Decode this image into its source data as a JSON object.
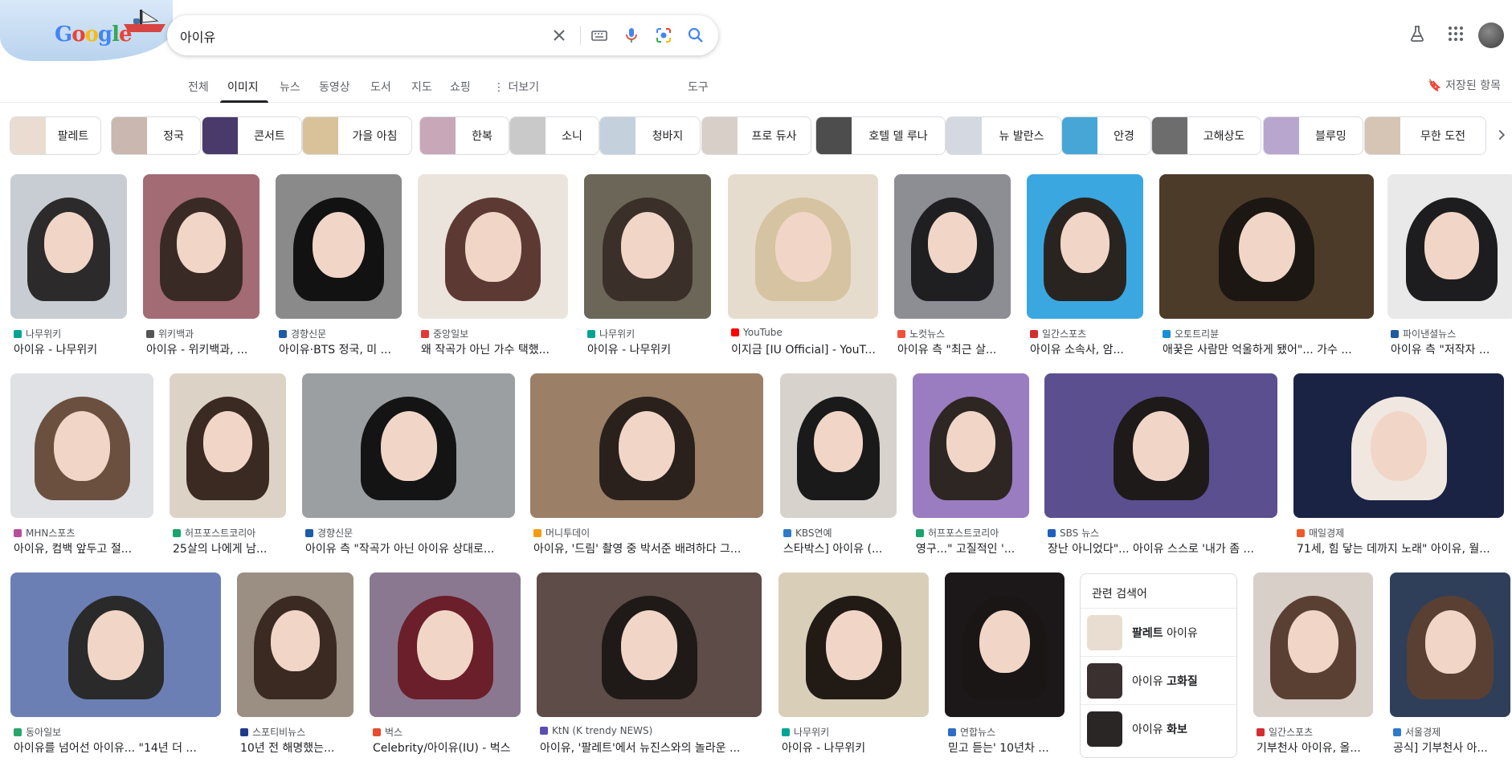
{
  "search": {
    "query": "아이유"
  },
  "tabs": [
    {
      "label": "전체"
    },
    {
      "label": "이미지"
    },
    {
      "label": "뉴스"
    },
    {
      "label": "동영상"
    },
    {
      "label": "도서"
    },
    {
      "label": "지도"
    },
    {
      "label": "쇼핑"
    },
    {
      "label": "더보기"
    },
    {
      "label": "도구"
    }
  ],
  "saved_label": "저장된 항목",
  "chips": [
    {
      "label": "팔레트",
      "color": "#e8ddd0"
    },
    {
      "label": "정국",
      "color": "#c9b7b0"
    },
    {
      "label": "콘서트",
      "color": "#4a3a6b"
    },
    {
      "label": "가을 아침",
      "color": "#d9c29a"
    },
    {
      "label": "한복",
      "color": "#c8a7b8"
    },
    {
      "label": "소니",
      "color": "#c9c9c9"
    },
    {
      "label": "청바지",
      "color": "#c4d0dc"
    },
    {
      "label": "프로 듀사",
      "color": "#d8d0c8"
    },
    {
      "label": "호텔 델 루나",
      "color": "#4d4d4d"
    },
    {
      "label": "뉴 발란스",
      "color": "#d4d8e0"
    },
    {
      "label": "안경",
      "color": "#47a6d6"
    },
    {
      "label": "고해상도",
      "color": "#6d6d6d"
    },
    {
      "label": "블루밍",
      "color": "#b8a6cf"
    },
    {
      "label": "무한 도전",
      "color": "#d6c4b4"
    }
  ],
  "row1": [
    {
      "source": "나무위키",
      "title": "아이유 - 나무위키",
      "fav": "#00a495",
      "bg": "#c7cdd3",
      "hair": "#2c2a2b"
    },
    {
      "source": "위키백과",
      "title": "아이유 - 위키백과, ...",
      "fav": "#555555",
      "bg": "#a36b74",
      "hair": "#3a2a26"
    },
    {
      "source": "경향신문",
      "title": "아이유·BTS 정국, 미 ...",
      "fav": "#1d5aa8",
      "bg": "#8a8a8a",
      "hair": "#121212"
    },
    {
      "source": "중앙일보",
      "title": "왜 작곡가 아닌 가수 택했...",
      "fav": "#e53935",
      "bg": "#ebe4dd",
      "hair": "#5c3a33"
    },
    {
      "source": "나무위키",
      "title": "아이유 - 나무위키",
      "fav": "#00a495",
      "bg": "#6c6659",
      "hair": "#3b2f29"
    },
    {
      "source": "YouTube",
      "title": "이지금 [IU Official] - YouT...",
      "fav": "#ff0000",
      "bg": "#e6dccd",
      "hair": "#d6c3a2"
    },
    {
      "source": "노컷뉴스",
      "title": "아이유 측 \"최근 살...",
      "fav": "#f0503c",
      "bg": "#8d8d94",
      "hair": "#1f1f22"
    },
    {
      "source": "일간스포츠",
      "title": "아이유 소속사, 암...",
      "fav": "#d32f2f",
      "bg": "#3ba7e0",
      "hair": "#2a2420"
    },
    {
      "source": "오토트리뷴",
      "title": "애꿎은 사람만 억울하게 됐어\"... 가수 ...",
      "fav": "#1a8fd6",
      "bg": "#4b3b28",
      "hair": "#1c1712"
    },
    {
      "source": "파이낸셜뉴스",
      "title": "아이유 측 \"저작자 ...",
      "fav": "#1e5aa0",
      "bg": "#e9e9ea",
      "hair": "#1d1d1f"
    }
  ],
  "row2": [
    {
      "source": "MHN스포츠",
      "title": "아이유, 컴백 앞두고 절...",
      "fav": "#b74f9d",
      "bg": "#dfe1e4",
      "hair": "#6b5040"
    },
    {
      "source": "허프포스트코리아",
      "title": "25살의 나에게 남...",
      "fav": "#1aa36b",
      "bg": "#dcd3c6",
      "hair": "#3a2a22"
    },
    {
      "source": "경향신문",
      "title": "아이유 측 \"작곡가 아닌 아이유 상대로...",
      "fav": "#1d5aa8",
      "bg": "#9c9fa2",
      "hair": "#141414"
    },
    {
      "source": "머니투데이",
      "title": "아이유, '드림' 촬영 중 박서준 배려하다 그...",
      "fav": "#f39c12",
      "bg": "#9b7f67",
      "hair": "#2a211c"
    },
    {
      "source": "KBS연예",
      "title": "스타박스] 아이유 (...",
      "fav": "#2c7ac9",
      "bg": "#d7d3cc",
      "hair": "#1b1a1a"
    },
    {
      "source": "허프포스트코리아",
      "title": "영구...\" 고질적인 '...",
      "fav": "#1aa36b",
      "bg": "#9a7cc0",
      "hair": "#2e2622"
    },
    {
      "source": "SBS 뉴스",
      "title": "장난 아니었다\"... 아이유 스스로 '내가 좀 ...",
      "fav": "#1f5fbf",
      "bg": "#5c4f8f",
      "hair": "#1e1a1a"
    },
    {
      "source": "매일경제",
      "title": "71세, 힘 닿는 데까지 노래\" 아이유, 월...",
      "fav": "#f05a28",
      "bg": "#1a2344",
      "hair": "#f0e8e0"
    }
  ],
  "row3": [
    {
      "source": "동아일보",
      "title": "아이유를 넘어선 아이유... \"14년 더 ...",
      "fav": "#2ba56a",
      "bg": "#6c7fb5",
      "hair": "#2a2a2a"
    },
    {
      "source": "스포티비뉴스",
      "title": "10년 전 해명했는...",
      "fav": "#1d3b8a",
      "bg": "#9a8f82",
      "hair": "#3a2a22"
    },
    {
      "source": "벅스",
      "title": "Celebrity/아이유(IU) - 벅스",
      "fav": "#e94b2c",
      "bg": "#8a7890",
      "hair": "#6b1f2a"
    },
    {
      "source": "KtN (K trendy NEWS)",
      "title": "아이유, '팔레트'에서 뉴진스와의 놀라운 ...",
      "fav": "#5a4fb0",
      "bg": "#5d4c47",
      "hair": "#1f1a18"
    },
    {
      "source": "나무위키",
      "title": "아이유 - 나무위키",
      "fav": "#00a495",
      "bg": "#d9cfb9",
      "hair": "#221a15"
    },
    {
      "source": "연합뉴스",
      "title": "믿고 듣는' 10년차 ...",
      "fav": "#2f6cc7",
      "bg": "#1c1718",
      "hair": "#1a1616"
    },
    {
      "source": "일간스포츠",
      "title": "기부천사 아이유, 올...",
      "fav": "#d32f2f",
      "bg": "#d8cfc8",
      "hair": "#5a4032"
    },
    {
      "source": "서울경제",
      "title": "공식] 기부천사 아...",
      "fav": "#2c7ac9",
      "bg": "#2f3f5a",
      "hair": "#5a4032"
    }
  ],
  "related": {
    "title": "관련 검색어",
    "items": [
      {
        "bold": "팔레트",
        "rest": " 아이유",
        "bold_first": true,
        "color": "#e8ddd0"
      },
      {
        "bold": "고화질",
        "rest": "아이유 ",
        "bold_first": false,
        "color": "#3a3030"
      },
      {
        "bold": "화보",
        "rest": "아이유 ",
        "bold_first": false,
        "color": "#2a2626"
      }
    ]
  }
}
